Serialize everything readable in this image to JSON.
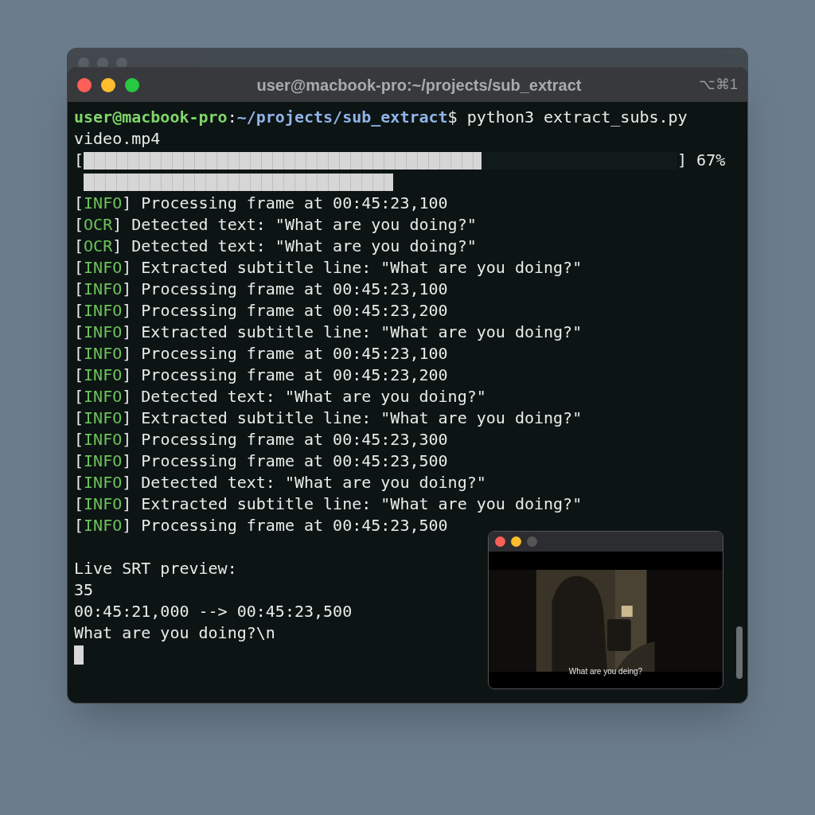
{
  "window": {
    "title": "user@macbook-pro:~/projects/sub_extract",
    "shortcut": "⌥⌘1"
  },
  "prompt": {
    "user_host": "user@macbook-pro",
    "separator": ":",
    "path": "~/projects/sub_extract",
    "symbol": "$",
    "command": "python3 extract_subs.py video.mp4"
  },
  "progress": {
    "open": "[",
    "close": "]",
    "level": 0.67,
    "reading": "67%"
  },
  "log": [
    {
      "open": "[",
      "tag": "INFO",
      "close": "]",
      "message": "Processing frame at 00:45:23,100"
    },
    {
      "open": "[",
      "tag": "OCR",
      "close": "]",
      "message": "Detected text: \"What are you doing?\""
    },
    {
      "open": "[",
      "tag": "OCR",
      "close": "]",
      "message": "Detected text: \"What are you doing?\""
    },
    {
      "open": "[",
      "tag": "INFO",
      "close": "]",
      "message": "Extracted subtitle line: \"What are you doing?\""
    },
    {
      "open": "[",
      "tag": "INFO",
      "close": "]",
      "message": "Processing frame at 00:45:23,100"
    },
    {
      "open": "[",
      "tag": "INFO",
      "close": "]",
      "message": "Processing frame at 00:45:23,200"
    },
    {
      "open": "[",
      "tag": "INFO",
      "close": "]",
      "message": "Extracted subtitle line: \"What are you doing?\""
    },
    {
      "open": "[",
      "tag": "INFO",
      "close": "]",
      "message": "Processing frame at 00:45:23,100"
    },
    {
      "open": "[",
      "tag": "INFO",
      "close": "]",
      "message": "Processing frame at 00:45:23,200"
    },
    {
      "open": "[",
      "tag": "INFO",
      "close": "]",
      "message": "Detected text: \"What are you doing?\""
    },
    {
      "open": "[",
      "tag": "INFO",
      "close": "]",
      "message": "Extracted subtitle line: \"What are you doing?\""
    },
    {
      "open": "[",
      "tag": "INFO",
      "close": "]",
      "message": "Processing frame at 00:45:23,300"
    },
    {
      "open": "[",
      "tag": "INFO",
      "close": "]",
      "message": "Processing frame at 00:45:23,500"
    },
    {
      "open": "[",
      "tag": "INFO",
      "close": "]",
      "message": "Detected text: \"What are you doing?\""
    },
    {
      "open": "[",
      "tag": "INFO",
      "close": "]",
      "message": "Extracted subtitle line: \"What are you doing?\""
    },
    {
      "open": "[",
      "tag": "INFO",
      "close": "]",
      "message": "Processing frame at 00:45:23,500"
    }
  ],
  "srt_preview": [
    "Live SRT preview:",
    "35",
    "00:45:21,000 --> 00:45:23,500",
    "What are you doing?\\n"
  ],
  "video_window": {
    "subtitle": "What are you deing?"
  }
}
